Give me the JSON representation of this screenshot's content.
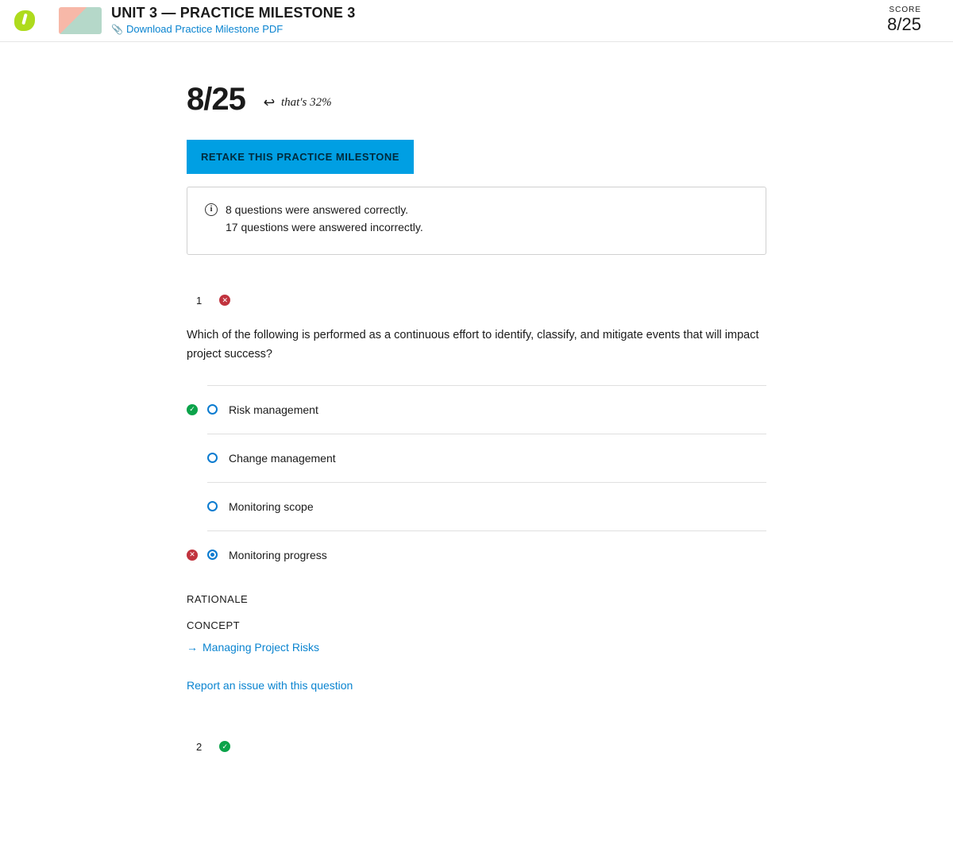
{
  "header": {
    "title": "UNIT 3 — PRACTICE MILESTONE 3",
    "download_label": "Download Practice Milestone PDF",
    "score_label": "SCORE",
    "score_value": "8/25"
  },
  "summary": {
    "big_score": "8/25",
    "percent_note": "that's 32%",
    "retake_label": "RETAKE THIS PRACTICE MILESTONE",
    "correct_line": "8 questions were answered correctly.",
    "incorrect_line": "17 questions were answered incorrectly."
  },
  "questions": [
    {
      "number": "1",
      "status": "wrong",
      "text": "Which of the following is performed as a continuous effort to identify, classify, and mitigate events that will impact project success?",
      "options": [
        {
          "label": "Risk management",
          "marker": "correct",
          "selected": false
        },
        {
          "label": "Change management",
          "marker": null,
          "selected": false
        },
        {
          "label": "Monitoring scope",
          "marker": null,
          "selected": false
        },
        {
          "label": "Monitoring progress",
          "marker": "wrong",
          "selected": true
        }
      ],
      "rationale_label": "RATIONALE",
      "concept_label": "CONCEPT",
      "concept_link": "Managing Project Risks",
      "report_label": "Report an issue with this question"
    },
    {
      "number": "2",
      "status": "correct"
    }
  ]
}
